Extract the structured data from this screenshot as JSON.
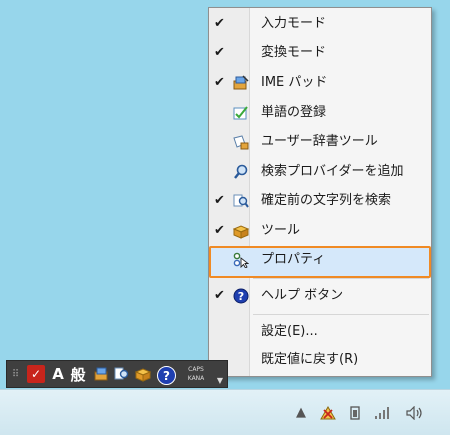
{
  "menu": {
    "items": [
      {
        "label": "入力モード",
        "checked": "✔",
        "icon": "none"
      },
      {
        "label": "変換モード",
        "checked": "✔",
        "icon": "none"
      },
      {
        "label": "IME パッド",
        "checked": "✔",
        "icon": "ime-pad-icon"
      },
      {
        "label": "単語の登録",
        "checked": "",
        "icon": "word-register-icon"
      },
      {
        "label": "ユーザー辞書ツール",
        "checked": "",
        "icon": "dictionary-tool-icon"
      },
      {
        "label": "検索プロバイダーを追加",
        "checked": "",
        "icon": "search-icon"
      },
      {
        "label": "確定前の文字列を検索",
        "checked": "✔",
        "icon": "search-text-icon"
      },
      {
        "label": "ツール",
        "checked": "✔",
        "icon": "toolbox-icon"
      },
      {
        "label": "プロパティ",
        "checked": "",
        "icon": "properties-icon"
      },
      {
        "label": "ヘルプ ボタン",
        "checked": "✔",
        "icon": "help-icon"
      },
      {
        "label": "設定(E)...",
        "checked": "",
        "icon": "none"
      },
      {
        "label": "既定値に戻す(R)",
        "checked": "",
        "icon": "none"
      }
    ]
  },
  "langbar": {
    "input_mode_glyph": "A",
    "conversion_glyph": "般",
    "caps_label": "CAPS",
    "kana_label": "KANA",
    "help_glyph": "?"
  },
  "bg_glyphs": {
    "a": "A",
    "kanji": "般"
  },
  "colors": {
    "desktop": "#97d6eb",
    "highlight": "#d5e8fa",
    "highlight_border": "#f08a24"
  }
}
